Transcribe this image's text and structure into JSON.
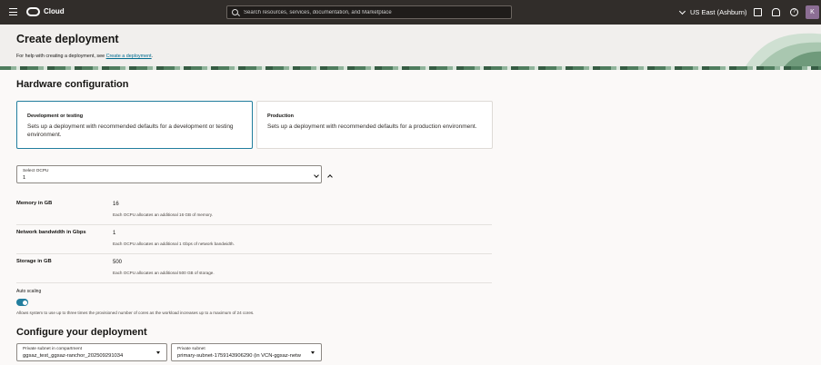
{
  "topbar": {
    "brand": "Cloud",
    "search_placeholder": "Search resources, services, documentation, and Marketplace",
    "region": "US East (Ashburn)",
    "help_glyph": "?",
    "avatar_initial": "K",
    "icons": [
      "menu-icon",
      "cloud-logo-icon",
      "search-icon",
      "chevron-down-icon",
      "chat-icon",
      "bell-icon",
      "help-icon"
    ]
  },
  "header": {
    "title": "Create deployment",
    "help_prefix": "For help with creating a deployment, see ",
    "help_link": "Create a deployment",
    "help_suffix": "."
  },
  "hardware": {
    "title": "Hardware configuration",
    "cards": [
      {
        "title": "Development or testing",
        "desc": "Sets up a deployment with recommended defaults for a development or testing environment.",
        "selected": true
      },
      {
        "title": "Production",
        "desc": "Sets up a deployment with recommended defaults for a production environment.",
        "selected": false
      }
    ],
    "ocpu": {
      "label": "Select OCPU",
      "value": "1"
    },
    "memory": {
      "label": "Memory in GB",
      "value": "16",
      "note": "Each OCPU allocates an additional 16 GB of memory."
    },
    "network": {
      "label": "Network bandwidth in Gbps",
      "value": "1",
      "note": "Each OCPU allocates an additional 1 Gbps of network bandwidth."
    },
    "storage": {
      "label": "Storage in GB",
      "value": "500",
      "note": "Each OCPU allocates an additional 500 GB of storage."
    },
    "autoscaling": {
      "label": "Auto scaling",
      "enabled": true,
      "note": "Allows system to use up to three times the provisioned number of cores as the workload increases up to a maximum of 24 cores."
    }
  },
  "configure": {
    "title": "Configure your deployment",
    "private_subnet_compartment": {
      "label": "Private subnet in compartment",
      "value": "ggsaz_test_ggsaz-ranchor_20250929103​4"
    },
    "private_subnet": {
      "label": "Private subnet",
      "value": "primary-subnet-1759143906290 (in VCN-ggsaz-netw"
    }
  },
  "colors": {
    "accent": "#227e9e",
    "topbar": "#312d2a",
    "link": "#006b8f"
  }
}
